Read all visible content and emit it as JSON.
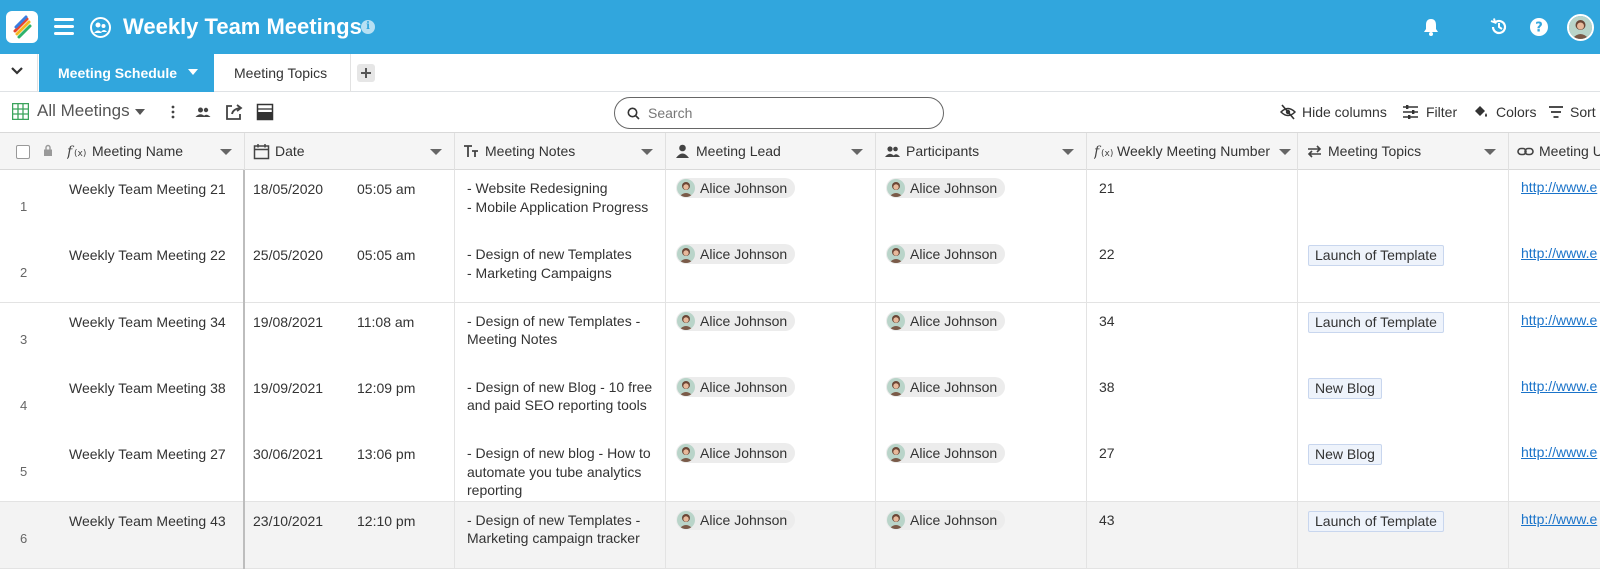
{
  "app": {
    "title": "Weekly Team Meetings",
    "info_glyph": "i",
    "brand_color": "#31a6dd"
  },
  "tabs": [
    {
      "label": "Meeting Schedule",
      "active": true
    },
    {
      "label": "Meeting Topics",
      "active": false
    }
  ],
  "toolbar": {
    "view_name": "All Meetings",
    "search_placeholder": "Search",
    "hide_columns_label": "Hide columns",
    "filter_label": "Filter",
    "colors_label": "Colors",
    "sort_label": "Sort"
  },
  "columns": [
    {
      "label": "Meeting Name",
      "icon": "formula-icon"
    },
    {
      "label": "Date",
      "icon": "calendar-icon"
    },
    {
      "label": "Meeting Notes",
      "icon": "text-type-icon"
    },
    {
      "label": "Meeting Lead",
      "icon": "person-icon"
    },
    {
      "label": "Participants",
      "icon": "people-icon"
    },
    {
      "label": "Weekly Meeting Number",
      "icon": "formula-icon"
    },
    {
      "label": "Meeting Topics",
      "icon": "link-arrows-icon"
    },
    {
      "label": "Meeting U",
      "icon": "url-link-icon"
    }
  ],
  "rows": [
    {
      "num": "1",
      "name": "Weekly Team Meeting 21",
      "date": "18/05/2020",
      "time": "05:05 am",
      "notes": "- Website Redesigning\n- Mobile Application Progress",
      "lead": "Alice Johnson",
      "participant": "Alice Johnson",
      "weekly_number": "21",
      "topic": "",
      "url": "http://www.e"
    },
    {
      "num": "2",
      "name": "Weekly Team Meeting 22",
      "date": "25/05/2020",
      "time": "05:05 am",
      "notes": "- Design of new Templates\n- Marketing Campaigns",
      "lead": "Alice Johnson",
      "participant": "Alice Johnson",
      "weekly_number": "22",
      "topic": "Launch of Template",
      "url": "http://www.e"
    },
    {
      "num": "3",
      "name": "Weekly Team Meeting 34",
      "date": "19/08/2021",
      "time": "11:08 am",
      "notes": "- Design of new Templates - Meeting Notes",
      "lead": "Alice Johnson",
      "participant": "Alice Johnson",
      "weekly_number": "34",
      "topic": "Launch of Template",
      "url": "http://www.e"
    },
    {
      "num": "4",
      "name": "Weekly Team Meeting 38",
      "date": "19/09/2021",
      "time": "12:09 pm",
      "notes": "- Design of new Blog - 10 free and paid SEO reporting tools",
      "lead": "Alice Johnson",
      "participant": "Alice Johnson",
      "weekly_number": "38",
      "topic": "New Blog",
      "url": "http://www.e"
    },
    {
      "num": "5",
      "name": "Weekly Team Meeting 27",
      "date": "30/06/2021",
      "time": "13:06 pm",
      "notes": "- Design of new blog - How to automate you tube analytics reporting",
      "lead": "Alice Johnson",
      "participant": "Alice Johnson",
      "weekly_number": "27",
      "topic": "New Blog",
      "url": "http://www.e"
    },
    {
      "num": "6",
      "name": "Weekly Team Meeting 43",
      "date": "23/10/2021",
      "time": "12:10 pm",
      "notes": "- Design of new Templates - Marketing campaign tracker",
      "lead": "Alice Johnson",
      "participant": "Alice Johnson",
      "weekly_number": "43",
      "topic": "Launch of Template",
      "url": "http://www.e"
    }
  ]
}
